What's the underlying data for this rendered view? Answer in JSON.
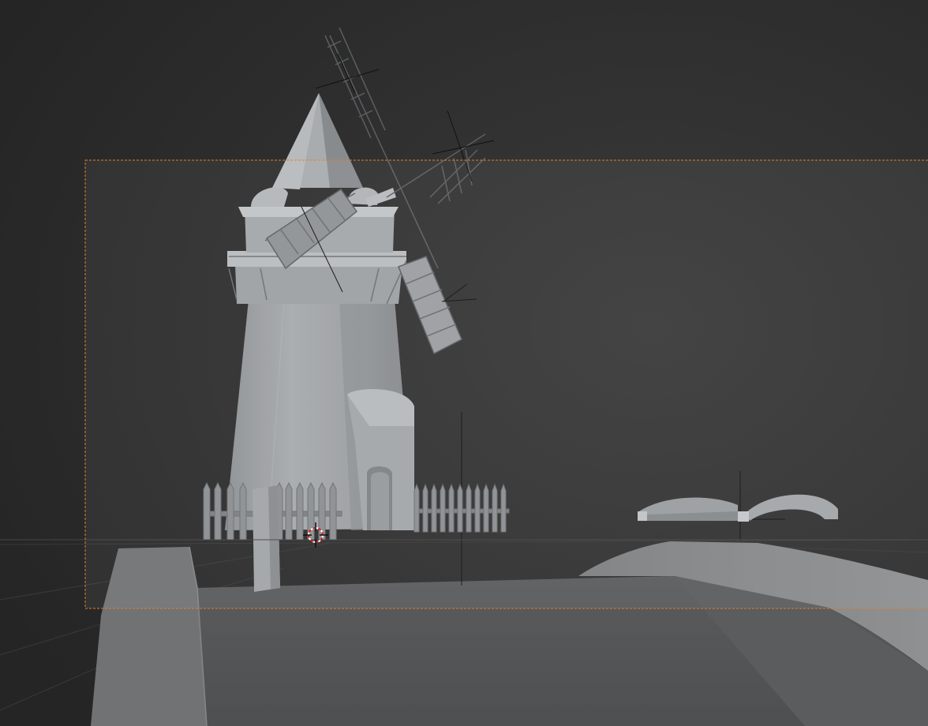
{
  "app": "3D viewport",
  "viewport": {
    "shading": "solid",
    "background_color": "#2b2b2b",
    "camera_frame_color": "#e0802a",
    "cursor_icon": "3d-cursor-icon"
  },
  "scene": {
    "objects": [
      "windmill-tower",
      "windmill-roof",
      "windmill-sails",
      "door-extension",
      "picket-fence-left",
      "picket-fence-right",
      "fence-post",
      "bridge",
      "ground-terrain",
      "hill",
      "empty-axis"
    ]
  }
}
